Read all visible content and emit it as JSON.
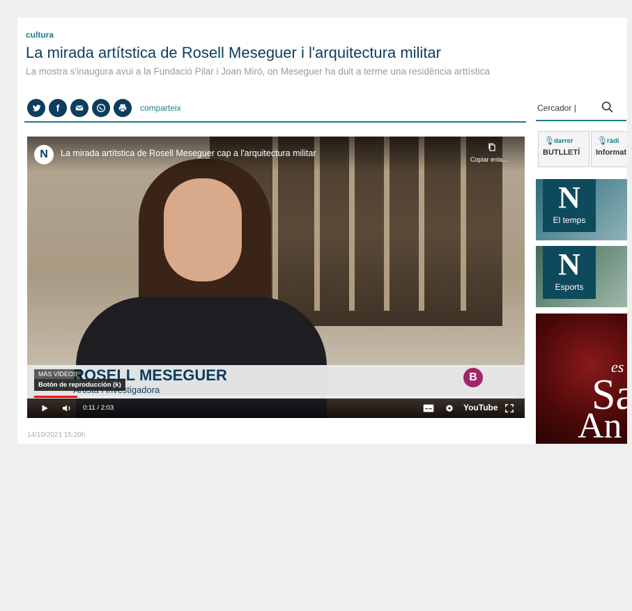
{
  "article": {
    "section": "cultura",
    "title": "La mirada artítstica de Rosell Meseguer i l'arquitectura militar",
    "subtitle": "La mostra s'inaugura avui a la Fundació Pilar i Joan Miró, on Meseguer ha duit a terme una residència arttística",
    "date": "14/10/2021 15:20h"
  },
  "share": {
    "label": "comparteix",
    "icons": [
      {
        "name": "twitter-icon",
        "glyph": "t"
      },
      {
        "name": "facebook-icon",
        "glyph": "f"
      },
      {
        "name": "email-icon",
        "glyph": "✉"
      },
      {
        "name": "whatsapp-icon",
        "glyph": "✆"
      },
      {
        "name": "print-icon",
        "glyph": "⎙"
      }
    ]
  },
  "search": {
    "label": "Cercador |"
  },
  "video": {
    "channel_logo": "N",
    "title": "La mirada artítstica de Rosell Meseguer cap a l'arquitectura militar",
    "copy_label": "Copiar enla...",
    "lower_third_name": "ROSELL MESEGUER",
    "lower_third_role": "Artista i investigadora",
    "broadcaster_logo": "B",
    "more_videos": "MÁS VÍDEOS",
    "tooltip": "Botón de reproducción (k)",
    "time": "0:11 / 2:03",
    "progress": 0.09,
    "brand": "YouTube"
  },
  "sidebar": {
    "buttons": [
      {
        "top": "darrer",
        "bottom": "BUTLLETÍ"
      },
      {
        "top": "ràdi",
        "bottom": "Informat"
      }
    ],
    "promos": [
      {
        "letter": "N",
        "label": "El temps"
      },
      {
        "letter": "N",
        "label": "Esports"
      }
    ],
    "ad": {
      "line1": "es",
      "line2": "Sa",
      "line3": "An"
    }
  },
  "colors": {
    "accent": "#1f7a8c",
    "brand": "#0b3d5c",
    "progress": "#ff0000"
  }
}
